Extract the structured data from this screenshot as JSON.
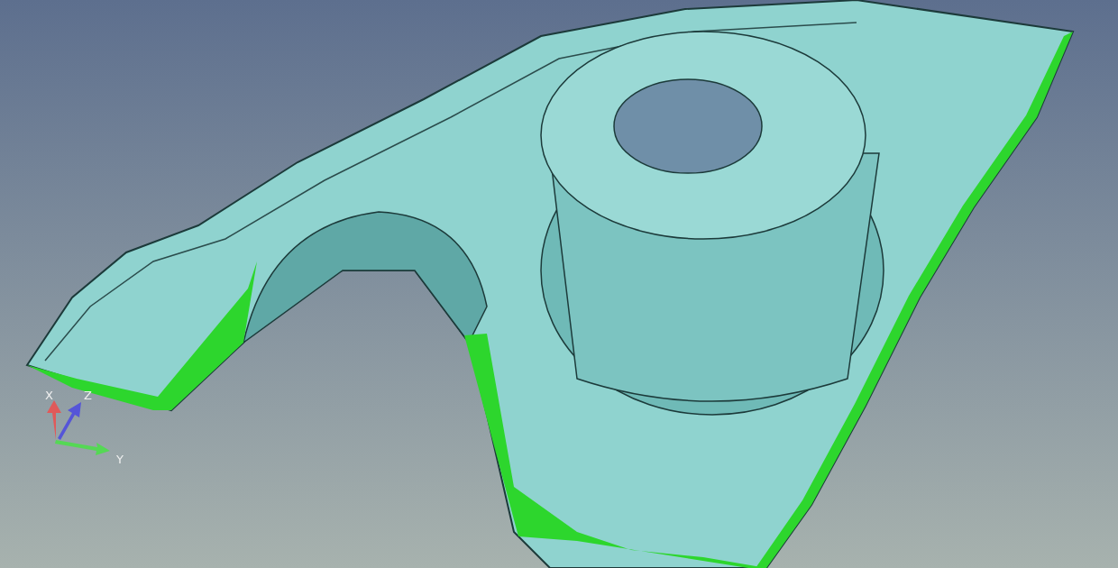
{
  "viewport": {
    "axes": [
      {
        "kind": "x",
        "label": "X",
        "color": "#e05a5a"
      },
      {
        "kind": "z",
        "label": "Z",
        "color": "#5555d8"
      },
      {
        "kind": "y",
        "label": "Y",
        "color": "#55d855"
      }
    ]
  }
}
